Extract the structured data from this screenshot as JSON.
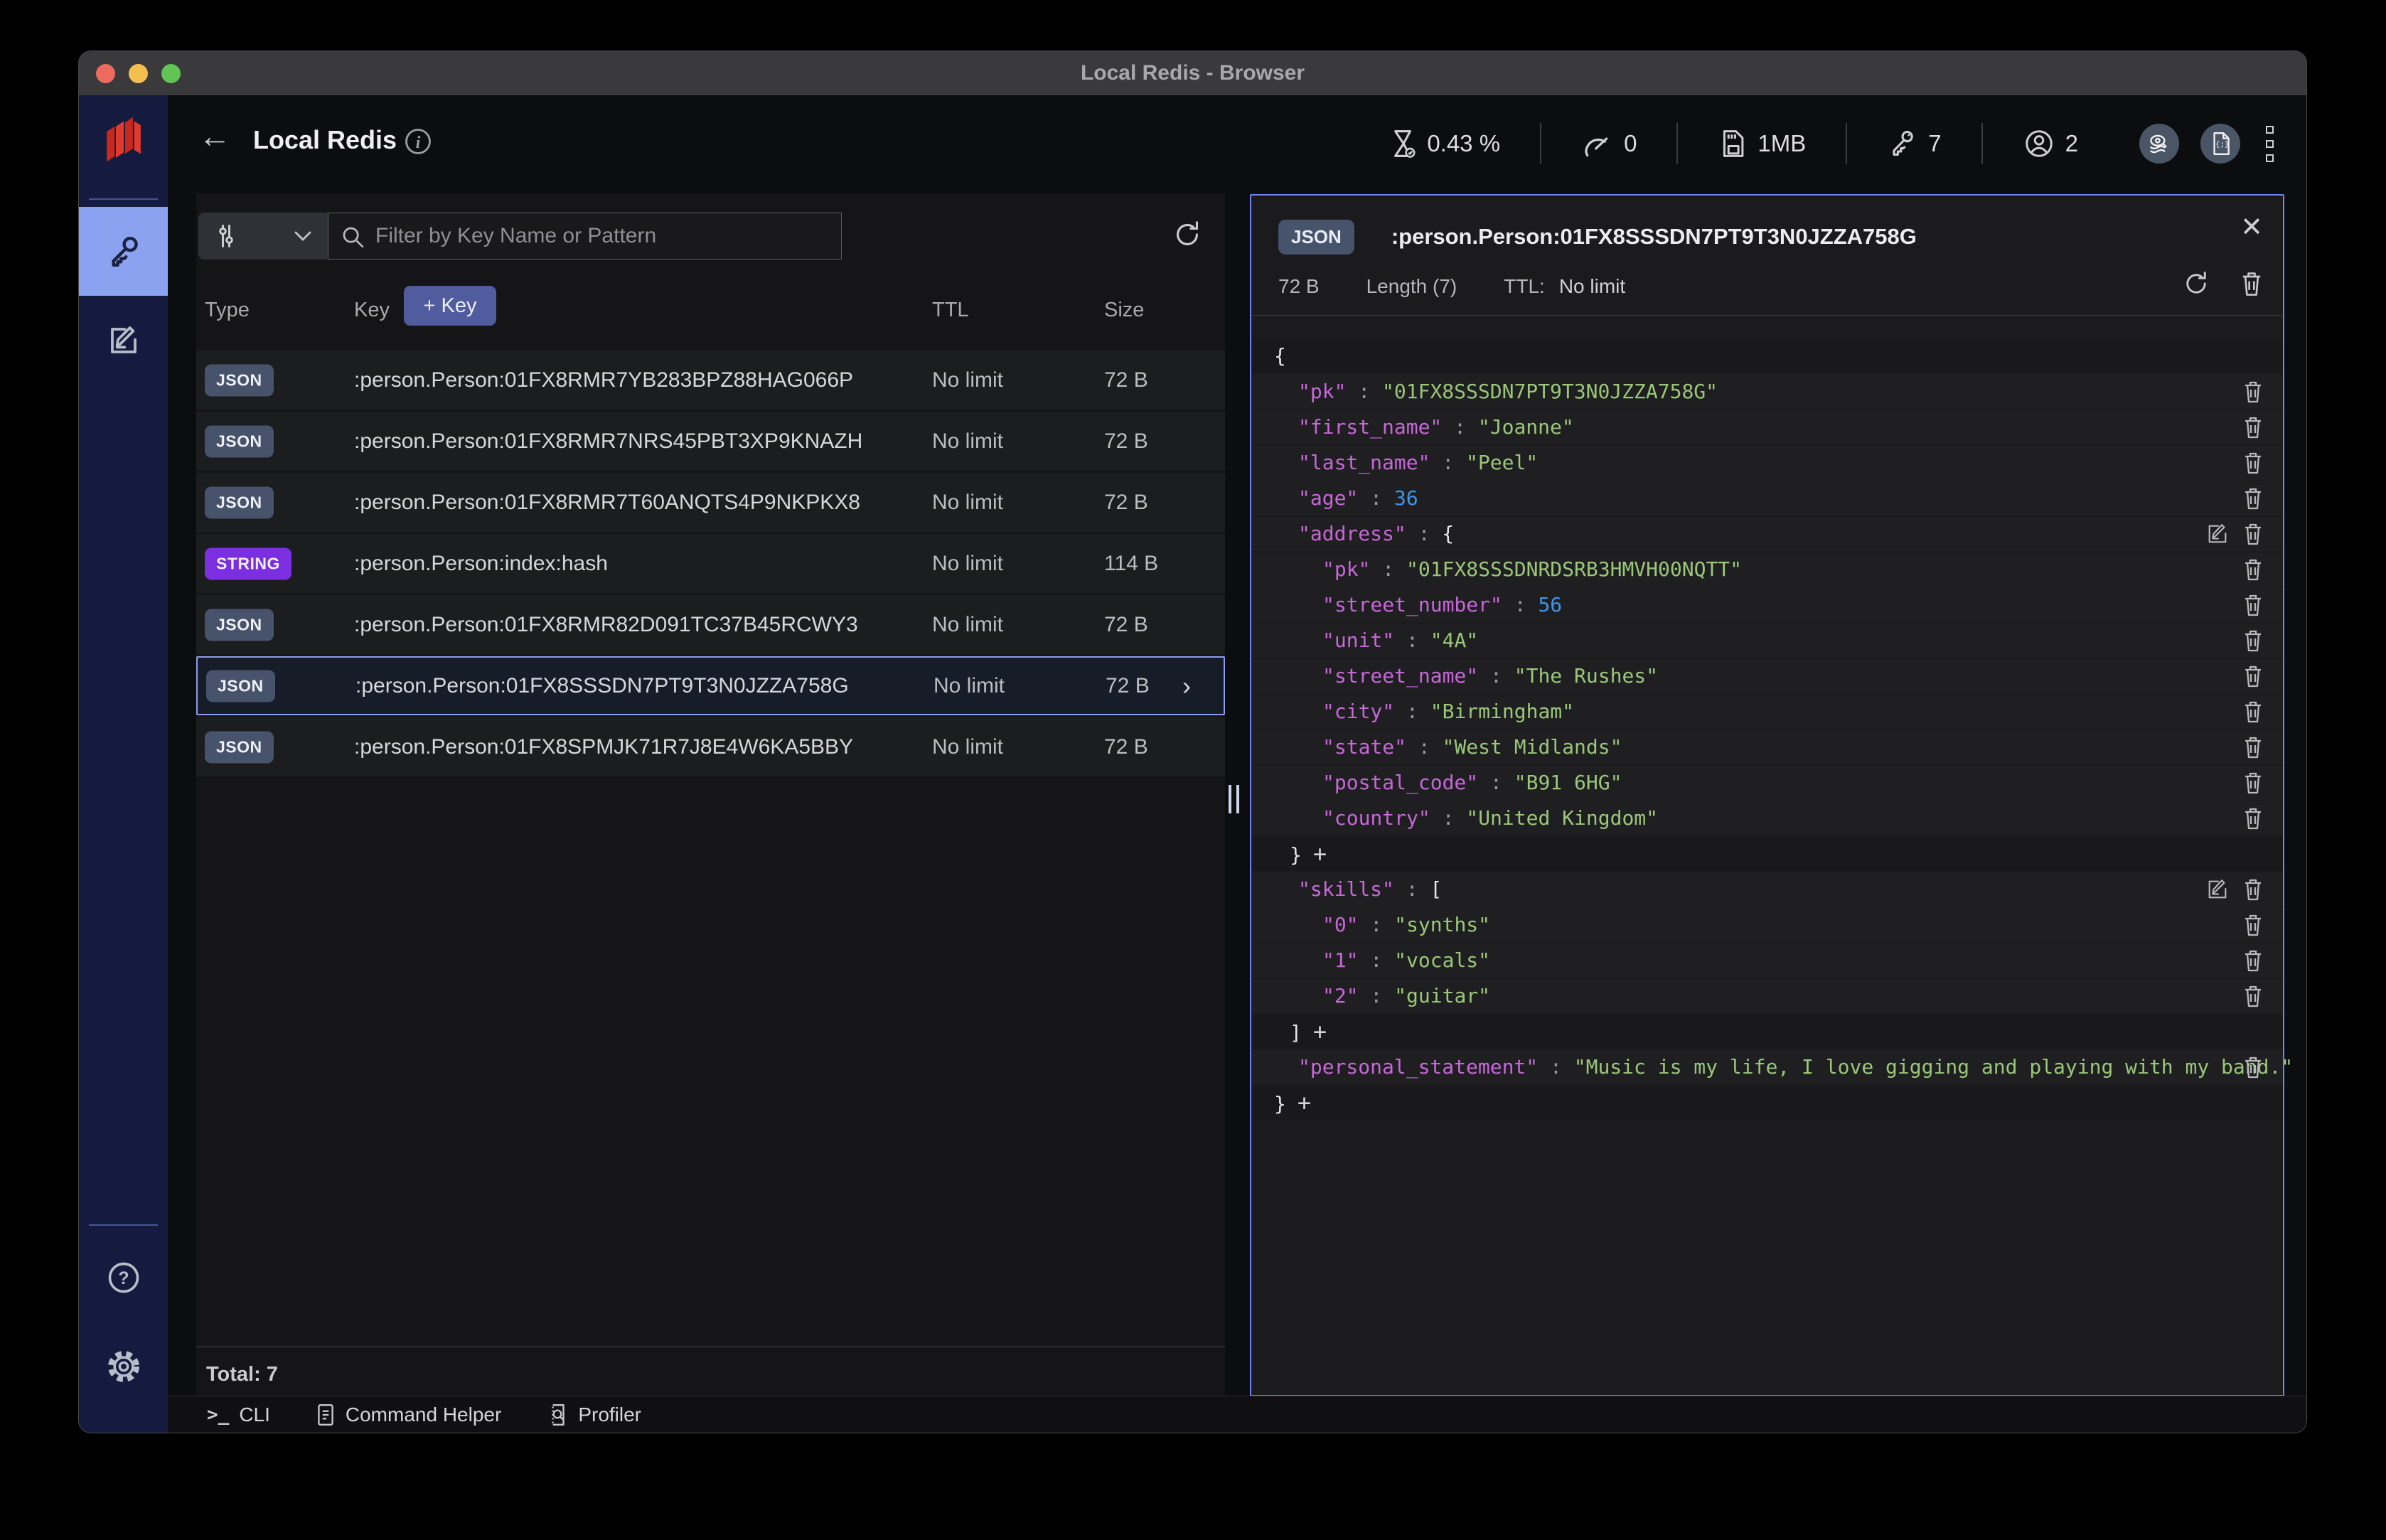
{
  "window": {
    "title": "Local Redis - Browser"
  },
  "header": {
    "db_name": "Local Redis",
    "stats": [
      {
        "id": "cpu",
        "icon": "hourglass-icon",
        "value": "0.43 %"
      },
      {
        "id": "commands-per-sec",
        "icon": "gauge-icon",
        "value": "0"
      },
      {
        "id": "memory",
        "icon": "memory-card-icon",
        "value": "1MB"
      },
      {
        "id": "total-keys",
        "icon": "key-icon",
        "value": "7"
      },
      {
        "id": "connected-clients",
        "icon": "user-icon",
        "value": "2"
      }
    ]
  },
  "filter": {
    "placeholder": "Filter by Key Name or Pattern"
  },
  "key_table": {
    "columns": {
      "type": "Type",
      "key": "Key",
      "ttl": "TTL",
      "size": "Size"
    },
    "add_key_label": "+ Key",
    "rows": [
      {
        "type": "JSON",
        "key": ":person.Person:01FX8RMR7YB283BPZ88HAG066P",
        "ttl": "No limit",
        "size": "72 B",
        "selected": false
      },
      {
        "type": "JSON",
        "key": ":person.Person:01FX8RMR7NRS45PBT3XP9KNAZH",
        "ttl": "No limit",
        "size": "72 B",
        "selected": false
      },
      {
        "type": "JSON",
        "key": ":person.Person:01FX8RMR7T60ANQTS4P9NKPKX8",
        "ttl": "No limit",
        "size": "72 B",
        "selected": false
      },
      {
        "type": "STRING",
        "key": ":person.Person:index:hash",
        "ttl": "No limit",
        "size": "114 B",
        "selected": false
      },
      {
        "type": "JSON",
        "key": ":person.Person:01FX8RMR82D091TC37B45RCWY3",
        "ttl": "No limit",
        "size": "72 B",
        "selected": false
      },
      {
        "type": "JSON",
        "key": ":person.Person:01FX8SSSDN7PT9T3N0JZZA758G",
        "ttl": "No limit",
        "size": "72 B",
        "selected": true
      },
      {
        "type": "JSON",
        "key": ":person.Person:01FX8SPMJK71R7J8E4W6KA5BBY",
        "ttl": "No limit",
        "size": "72 B",
        "selected": false
      }
    ],
    "total_label": "Total:",
    "total_value": "7"
  },
  "detail": {
    "badge": "JSON",
    "key": ":person.Person:01FX8SSSDN7PT9T3N0JZZA758G",
    "size": "72 B",
    "length": "Length (7)",
    "ttl_label": "TTL:",
    "ttl_value": "No limit",
    "lines": [
      {
        "kind": "open",
        "text": "{",
        "indent": 0
      },
      {
        "kind": "entry",
        "key": "pk",
        "value": "01FX8SSSDN7PT9T3N0JZZA758G",
        "vtype": "string",
        "indent": 1
      },
      {
        "kind": "entry",
        "key": "first_name",
        "value": "Joanne",
        "vtype": "string",
        "indent": 1
      },
      {
        "kind": "entry",
        "key": "last_name",
        "value": "Peel",
        "vtype": "string",
        "indent": 1
      },
      {
        "kind": "entry",
        "key": "age",
        "value": "36",
        "vtype": "number",
        "indent": 1
      },
      {
        "kind": "entry",
        "key": "address",
        "value": "{",
        "vtype": "open",
        "indent": 1
      },
      {
        "kind": "entry",
        "key": "pk",
        "value": "01FX8SSSDNRDSRB3HMVH00NQTT",
        "vtype": "string",
        "indent": 2
      },
      {
        "kind": "entry",
        "key": "street_number",
        "value": "56",
        "vtype": "number",
        "indent": 2
      },
      {
        "kind": "entry",
        "key": "unit",
        "value": "4A",
        "vtype": "string",
        "indent": 2
      },
      {
        "kind": "entry",
        "key": "street_name",
        "value": "The Rushes",
        "vtype": "string",
        "indent": 2
      },
      {
        "kind": "entry",
        "key": "city",
        "value": "Birmingham",
        "vtype": "string",
        "indent": 2
      },
      {
        "kind": "entry",
        "key": "state",
        "value": "West Midlands",
        "vtype": "string",
        "indent": 2
      },
      {
        "kind": "entry",
        "key": "postal_code",
        "value": "B91 6HG",
        "vtype": "string",
        "indent": 2
      },
      {
        "kind": "entry",
        "key": "country",
        "value": "United Kingdom",
        "vtype": "string",
        "indent": 2
      },
      {
        "kind": "close",
        "text": "}",
        "indent": 1
      },
      {
        "kind": "entry",
        "key": "skills",
        "value": "[",
        "vtype": "open",
        "indent": 1
      },
      {
        "kind": "entry",
        "key": "0",
        "value": "synths",
        "vtype": "string",
        "indent": 2
      },
      {
        "kind": "entry",
        "key": "1",
        "value": "vocals",
        "vtype": "string",
        "indent": 2
      },
      {
        "kind": "entry",
        "key": "2",
        "value": "guitar",
        "vtype": "string",
        "indent": 2
      },
      {
        "kind": "close",
        "text": "]",
        "indent": 1
      },
      {
        "kind": "entry",
        "key": "personal_statement",
        "value": "Music is my life, I love gigging and playing with my band.",
        "vtype": "string",
        "indent": 1
      },
      {
        "kind": "close",
        "text": "}",
        "indent": 0
      }
    ]
  },
  "bottom_bar": {
    "cli": "CLI",
    "command_helper": "Command Helper",
    "profiler": "Profiler"
  },
  "colors": {
    "accent": "#8ba2f0",
    "panel_border": "#6f83f2",
    "json_badge": "#47536b",
    "string_badge": "#7b2fe0",
    "json_key": "#c767d8",
    "json_string": "#9ac778",
    "json_number": "#3f94e8",
    "redis_red": "#d23228"
  }
}
